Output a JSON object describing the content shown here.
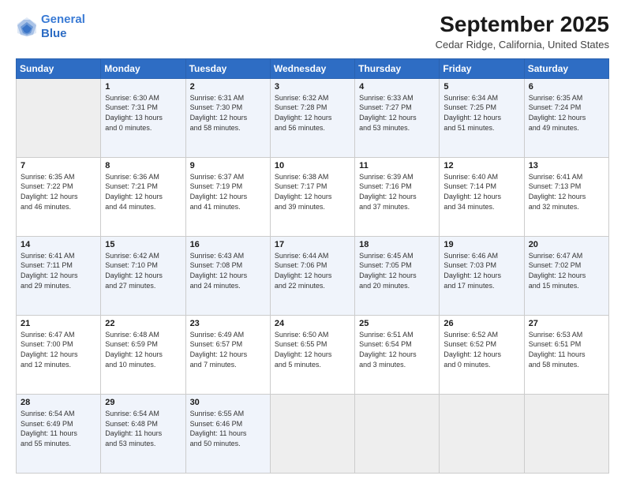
{
  "logo": {
    "line1": "General",
    "line2": "Blue"
  },
  "title": "September 2025",
  "subtitle": "Cedar Ridge, California, United States",
  "days_of_week": [
    "Sunday",
    "Monday",
    "Tuesday",
    "Wednesday",
    "Thursday",
    "Friday",
    "Saturday"
  ],
  "weeks": [
    [
      {
        "day": "",
        "content": ""
      },
      {
        "day": "1",
        "content": "Sunrise: 6:30 AM\nSunset: 7:31 PM\nDaylight: 13 hours\nand 0 minutes."
      },
      {
        "day": "2",
        "content": "Sunrise: 6:31 AM\nSunset: 7:30 PM\nDaylight: 12 hours\nand 58 minutes."
      },
      {
        "day": "3",
        "content": "Sunrise: 6:32 AM\nSunset: 7:28 PM\nDaylight: 12 hours\nand 56 minutes."
      },
      {
        "day": "4",
        "content": "Sunrise: 6:33 AM\nSunset: 7:27 PM\nDaylight: 12 hours\nand 53 minutes."
      },
      {
        "day": "5",
        "content": "Sunrise: 6:34 AM\nSunset: 7:25 PM\nDaylight: 12 hours\nand 51 minutes."
      },
      {
        "day": "6",
        "content": "Sunrise: 6:35 AM\nSunset: 7:24 PM\nDaylight: 12 hours\nand 49 minutes."
      }
    ],
    [
      {
        "day": "7",
        "content": "Sunrise: 6:35 AM\nSunset: 7:22 PM\nDaylight: 12 hours\nand 46 minutes."
      },
      {
        "day": "8",
        "content": "Sunrise: 6:36 AM\nSunset: 7:21 PM\nDaylight: 12 hours\nand 44 minutes."
      },
      {
        "day": "9",
        "content": "Sunrise: 6:37 AM\nSunset: 7:19 PM\nDaylight: 12 hours\nand 41 minutes."
      },
      {
        "day": "10",
        "content": "Sunrise: 6:38 AM\nSunset: 7:17 PM\nDaylight: 12 hours\nand 39 minutes."
      },
      {
        "day": "11",
        "content": "Sunrise: 6:39 AM\nSunset: 7:16 PM\nDaylight: 12 hours\nand 37 minutes."
      },
      {
        "day": "12",
        "content": "Sunrise: 6:40 AM\nSunset: 7:14 PM\nDaylight: 12 hours\nand 34 minutes."
      },
      {
        "day": "13",
        "content": "Sunrise: 6:41 AM\nSunset: 7:13 PM\nDaylight: 12 hours\nand 32 minutes."
      }
    ],
    [
      {
        "day": "14",
        "content": "Sunrise: 6:41 AM\nSunset: 7:11 PM\nDaylight: 12 hours\nand 29 minutes."
      },
      {
        "day": "15",
        "content": "Sunrise: 6:42 AM\nSunset: 7:10 PM\nDaylight: 12 hours\nand 27 minutes."
      },
      {
        "day": "16",
        "content": "Sunrise: 6:43 AM\nSunset: 7:08 PM\nDaylight: 12 hours\nand 24 minutes."
      },
      {
        "day": "17",
        "content": "Sunrise: 6:44 AM\nSunset: 7:06 PM\nDaylight: 12 hours\nand 22 minutes."
      },
      {
        "day": "18",
        "content": "Sunrise: 6:45 AM\nSunset: 7:05 PM\nDaylight: 12 hours\nand 20 minutes."
      },
      {
        "day": "19",
        "content": "Sunrise: 6:46 AM\nSunset: 7:03 PM\nDaylight: 12 hours\nand 17 minutes."
      },
      {
        "day": "20",
        "content": "Sunrise: 6:47 AM\nSunset: 7:02 PM\nDaylight: 12 hours\nand 15 minutes."
      }
    ],
    [
      {
        "day": "21",
        "content": "Sunrise: 6:47 AM\nSunset: 7:00 PM\nDaylight: 12 hours\nand 12 minutes."
      },
      {
        "day": "22",
        "content": "Sunrise: 6:48 AM\nSunset: 6:59 PM\nDaylight: 12 hours\nand 10 minutes."
      },
      {
        "day": "23",
        "content": "Sunrise: 6:49 AM\nSunset: 6:57 PM\nDaylight: 12 hours\nand 7 minutes."
      },
      {
        "day": "24",
        "content": "Sunrise: 6:50 AM\nSunset: 6:55 PM\nDaylight: 12 hours\nand 5 minutes."
      },
      {
        "day": "25",
        "content": "Sunrise: 6:51 AM\nSunset: 6:54 PM\nDaylight: 12 hours\nand 3 minutes."
      },
      {
        "day": "26",
        "content": "Sunrise: 6:52 AM\nSunset: 6:52 PM\nDaylight: 12 hours\nand 0 minutes."
      },
      {
        "day": "27",
        "content": "Sunrise: 6:53 AM\nSunset: 6:51 PM\nDaylight: 11 hours\nand 58 minutes."
      }
    ],
    [
      {
        "day": "28",
        "content": "Sunrise: 6:54 AM\nSunset: 6:49 PM\nDaylight: 11 hours\nand 55 minutes."
      },
      {
        "day": "29",
        "content": "Sunrise: 6:54 AM\nSunset: 6:48 PM\nDaylight: 11 hours\nand 53 minutes."
      },
      {
        "day": "30",
        "content": "Sunrise: 6:55 AM\nSunset: 6:46 PM\nDaylight: 11 hours\nand 50 minutes."
      },
      {
        "day": "",
        "content": ""
      },
      {
        "day": "",
        "content": ""
      },
      {
        "day": "",
        "content": ""
      },
      {
        "day": "",
        "content": ""
      }
    ]
  ]
}
